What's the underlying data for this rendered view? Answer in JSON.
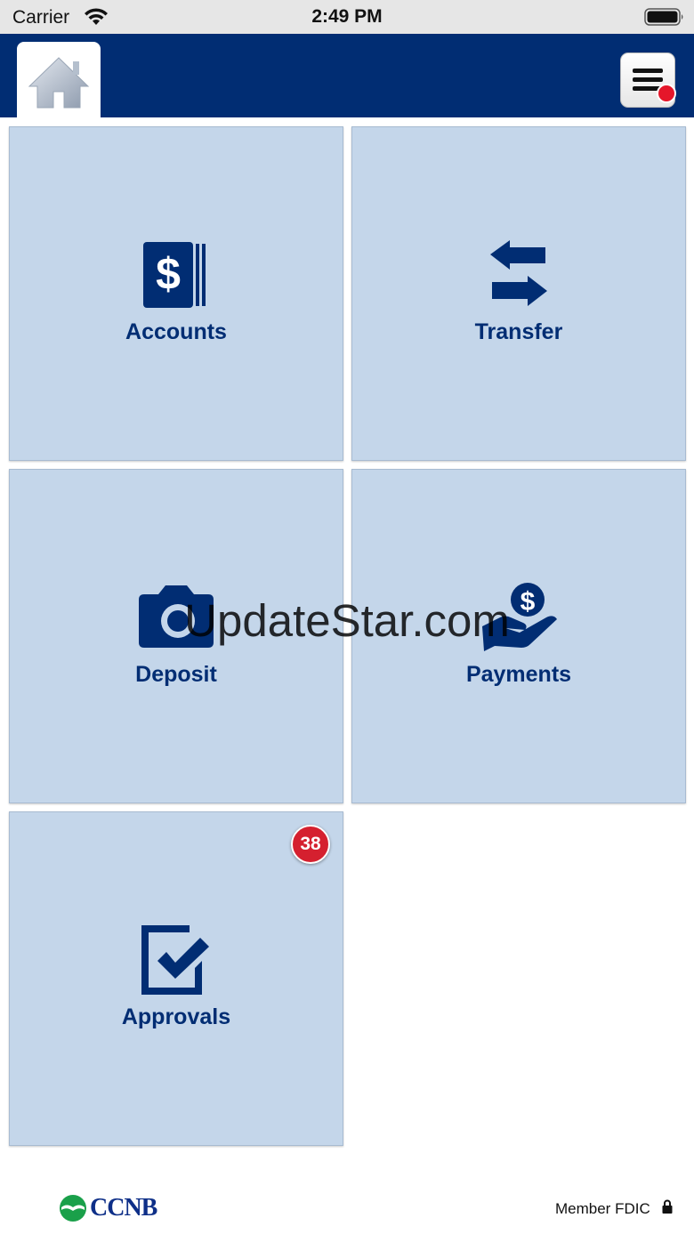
{
  "status_bar": {
    "carrier": "Carrier",
    "time": "2:49 PM"
  },
  "header": {
    "home_icon": "home-icon",
    "menu_icon": "hamburger-menu-icon",
    "has_notification": true,
    "brand_color": "#012d73"
  },
  "tiles": [
    {
      "label": "Accounts",
      "icon": "dollar-card-icon"
    },
    {
      "label": "Transfer",
      "icon": "transfer-arrows-icon"
    },
    {
      "label": "Deposit",
      "icon": "camera-icon"
    },
    {
      "label": "Payments",
      "icon": "hand-coin-icon"
    },
    {
      "label": "Approvals",
      "icon": "checkbox-icon",
      "badge": "38"
    }
  ],
  "tile_color": "#c4d6ea",
  "badge_color": "#d5202f",
  "watermark": "UpdateStar.com",
  "footer": {
    "logo_text": "CCNB",
    "fdic_text": "Member FDIC",
    "lock_icon": "lock-icon"
  }
}
